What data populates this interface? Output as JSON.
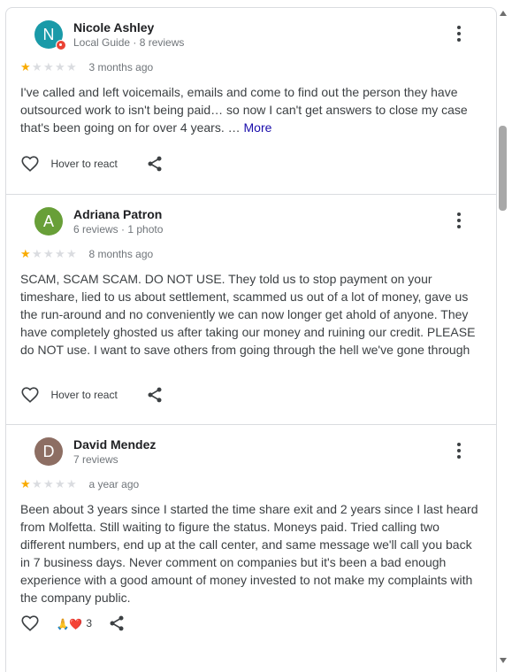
{
  "reviews": [
    {
      "avatar_letter": "N",
      "avatar_color": "#1a9aa8",
      "local_guide": true,
      "name": "Nicole Ashley",
      "meta": "Local Guide · 8 reviews",
      "rating": 1,
      "date": "3 months ago",
      "text": "I've called and left voicemails, emails and come to find out the person they have outsourced work to isn't being paid… so now I can't get answers to close my case that's been going on for over 4 years. …",
      "more_label": "More",
      "react_label": "Hover to react"
    },
    {
      "avatar_letter": "A",
      "avatar_color": "#689f38",
      "name": "Adriana Patron",
      "meta": "6 reviews · 1 photo",
      "rating": 1,
      "date": "8 months ago",
      "text": "SCAM, SCAM SCAM. DO NOT USE. They told us to stop payment on your timeshare, lied to us about settlement, scammed us out of a lot of money, gave us the run-around and no conveniently we can now longer get ahold of anyone. They have completely ghosted us after taking our money and ruining our credit. PLEASE do NOT use. I want to save others from going through the hell we've gone through",
      "react_label": "Hover to react"
    },
    {
      "avatar_letter": "D",
      "avatar_color": "#8d6e63",
      "name": "David Mendez",
      "meta": "7 reviews",
      "rating": 1,
      "date": "a year ago",
      "text": "Been about 3 years since I started the time share exit and 2 years since I last heard from Molfetta. Still waiting to figure the status. Moneys paid. Tried calling two different numbers, end up at the call center, and same message we'll call you back in 7 business days. Never comment on companies but it's been a bad enough experience with a good amount of money invested to not make my complaints with the company public.",
      "reaction_emojis": "🙏❤️",
      "reaction_count": "3"
    }
  ],
  "colors": {
    "star_on": "#f9ab00",
    "star_off": "#dadce0",
    "link": "#1a0dab"
  }
}
